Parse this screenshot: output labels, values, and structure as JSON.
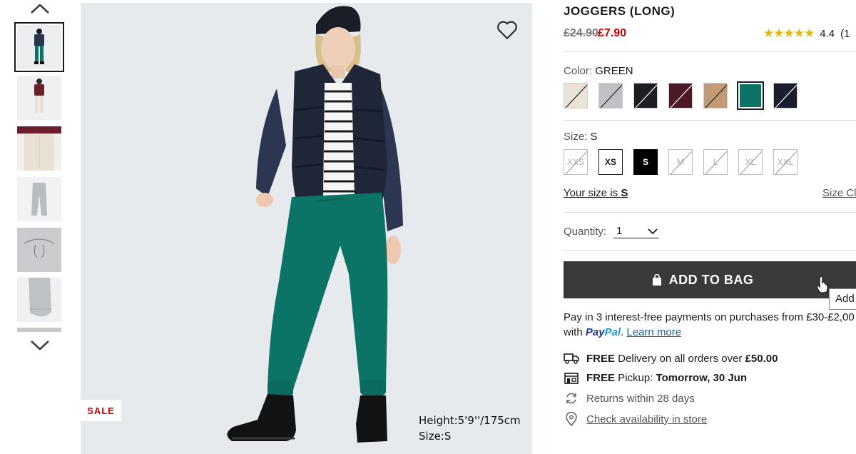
{
  "product": {
    "title": "JOGGERS (LONG)",
    "price_original": "£24.90",
    "price_sale": "£7.90",
    "rating_value": "4.4",
    "rating_count_partial": "(1",
    "stars": "★★★★★",
    "rating_fraction": 0.88
  },
  "gallery": {
    "sale_badge": "SALE",
    "model_height": "Height:5'9''/175cm",
    "model_size": "Size:S",
    "thumbnails": [
      "thumb-1",
      "thumb-2",
      "thumb-3",
      "thumb-4",
      "thumb-5",
      "thumb-6"
    ],
    "active_thumbnail": 1
  },
  "color": {
    "label": "Color:",
    "selected": "GREEN",
    "swatches": [
      {
        "hex": "#eae3d8",
        "available": false
      },
      {
        "hex": "#bfc1c4",
        "available": false
      },
      {
        "hex": "#1c1e22",
        "available": false
      },
      {
        "hex": "#4b1a25",
        "available": false
      },
      {
        "hex": "#c29a76",
        "available": false
      },
      {
        "hex": "#0b7467",
        "available": true,
        "selected": true
      },
      {
        "hex": "#1a1d2b",
        "available": false
      }
    ]
  },
  "size": {
    "label": "Size:",
    "selected": "S",
    "options": [
      {
        "label": "XXS",
        "available": false
      },
      {
        "label": "XS",
        "available": true
      },
      {
        "label": "S",
        "available": true,
        "selected": true
      },
      {
        "label": "M",
        "available": false
      },
      {
        "label": "L",
        "available": false
      },
      {
        "label": "XL",
        "available": false
      },
      {
        "label": "XXL",
        "available": false
      }
    ],
    "your_size_prefix": "Your size is ",
    "your_size_value": "S",
    "size_chart_link": "Size Cl"
  },
  "quantity": {
    "label": "Quantity:",
    "value": "1"
  },
  "cart": {
    "add_to_bag": "ADD TO BAG",
    "tooltip": "Add"
  },
  "payments": {
    "line1": "Pay in 3 interest-free payments on purchases from £30-£2,00",
    "with": "with ",
    "paypal_pay": "Pay",
    "paypal_pal": "Pal",
    "dot": ".",
    "learn_more": "Learn more"
  },
  "delivery": {
    "free_label": "FREE",
    "delivery_text": " Delivery on all orders over ",
    "delivery_threshold": "£50.00",
    "pickup_free": "FREE",
    "pickup_text": " Pickup: ",
    "pickup_when": "Tomorrow, 30 Jun",
    "returns": "Returns within 28 days",
    "check_store": "Check availability in store"
  },
  "colors": {
    "sale_red": "#cc0000",
    "button_dark": "#3a3a3a",
    "star_gold": "#e9b40c",
    "paypal_blue": "#1b3a8f",
    "paypal_light": "#179bd7"
  }
}
